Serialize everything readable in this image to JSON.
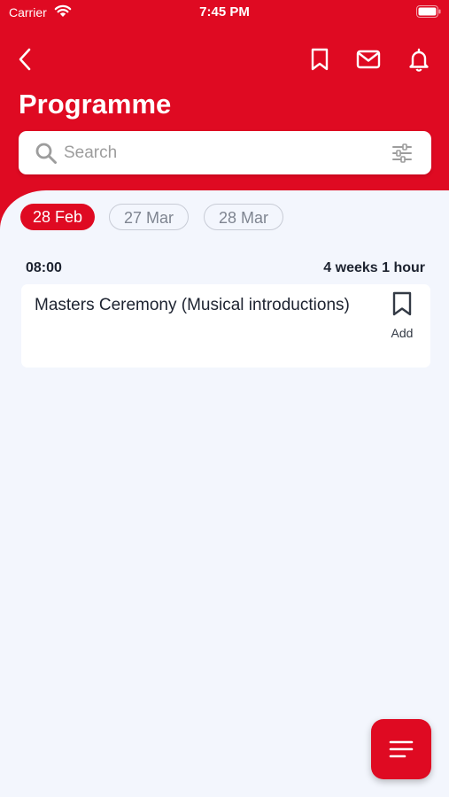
{
  "status_bar": {
    "carrier": "Carrier",
    "time": "7:45 PM"
  },
  "header": {
    "title": "Programme",
    "icons": [
      "back-chevron-icon",
      "bookmark-icon",
      "mail-icon",
      "bell-icon"
    ]
  },
  "search": {
    "placeholder": "Search",
    "value": ""
  },
  "date_tabs": [
    {
      "label": "28 Feb",
      "selected": true
    },
    {
      "label": "27 Mar",
      "selected": false
    },
    {
      "label": "28 Mar",
      "selected": false
    }
  ],
  "schedule": {
    "slots": [
      {
        "time": "08:00",
        "duration": "4 weeks 1 hour",
        "events": [
          {
            "title": "Masters Ceremony (Musical introductions)",
            "action_label": "Add"
          }
        ]
      }
    ]
  },
  "colors": {
    "brand_red": "#df0a22",
    "background": "#f3f6fd",
    "card": "#ffffff",
    "text_dark": "#1d2330",
    "tab_border": "#c8ccd6",
    "tab_text": "#7f8591"
  }
}
